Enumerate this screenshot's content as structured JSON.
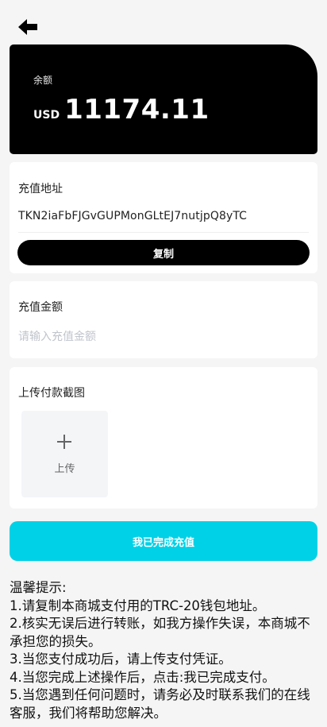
{
  "balance": {
    "label": "余额",
    "currency": "USD",
    "amount": "11174.11"
  },
  "address_card": {
    "title": "充值地址",
    "address": "TKN2iaFbFJGvGUPMonGLtEJ7nutjpQ8yTC",
    "copy_label": "复制"
  },
  "amount_card": {
    "title": "充值金额",
    "placeholder": "请输入充值金额"
  },
  "upload_card": {
    "title": "上传付款截图",
    "upload_label": "上传"
  },
  "submit_label": "我已完成充值",
  "tips": {
    "heading": "温馨提示:",
    "lines": [
      "1.请复制本商城支付用的TRC-20钱包地址。",
      "2.核实无误后进行转账，如我方操作失误，本商城不承担您的损失。",
      "3.当您支付成功后，请上传支付凭证。",
      "4.当您完成上述操作后，点击:我已完成支付。",
      "5.当您遇到任何问题时，请务必及时联系我们的在线客服，我们将帮助您解决。"
    ]
  },
  "icons": {
    "back": "arrow-left-icon",
    "upload": "plus-icon"
  },
  "colors": {
    "accent": "#00d1e6",
    "card_dark": "#000000",
    "background": "#f5f5f5"
  }
}
